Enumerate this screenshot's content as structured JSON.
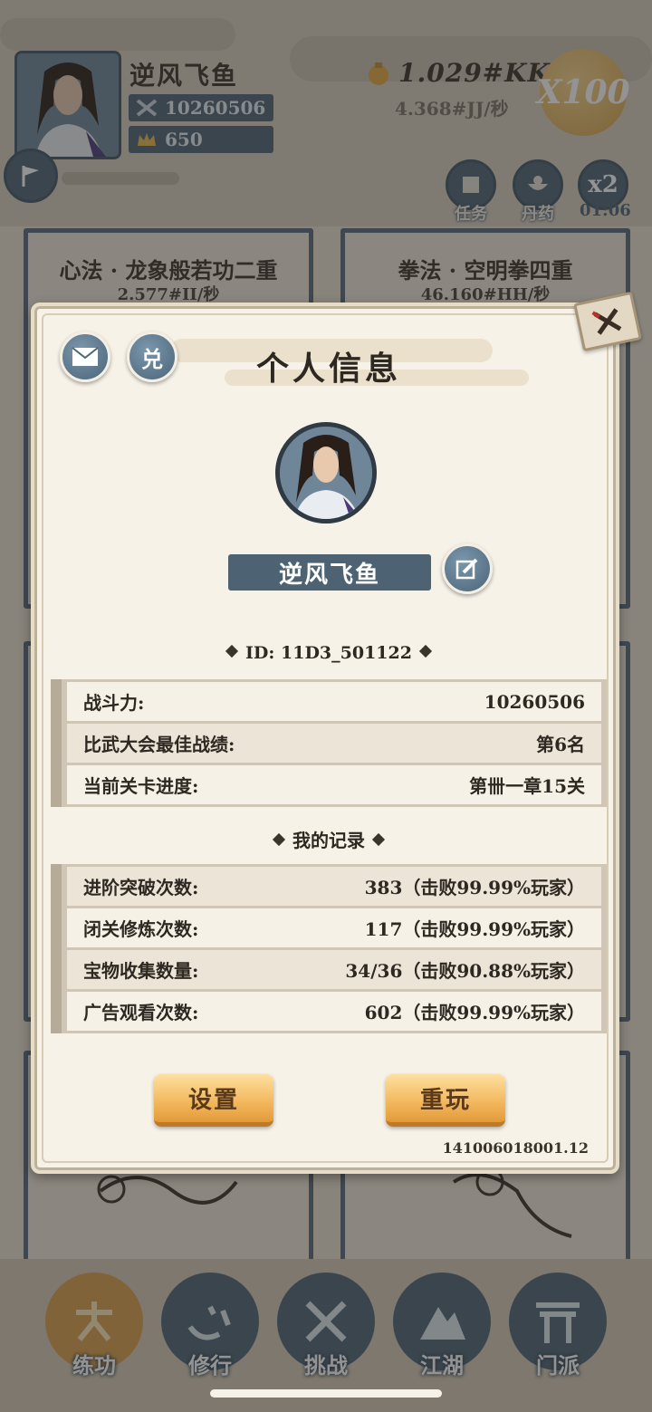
{
  "player": {
    "name": "逆风飞鱼",
    "power": "10260506",
    "crown": "650"
  },
  "currency": {
    "gold": "1.029#KK",
    "rate": "4.368#JJ/秒",
    "multiplier": "X100"
  },
  "top_buttons": {
    "task": "任务",
    "pill": "丹药",
    "x2": "x2",
    "x2_timer": "01:06"
  },
  "skills": [
    {
      "title": "心法 · 龙象般若功二重",
      "rate": "2.577#II/秒"
    },
    {
      "title": "拳法 · 空明拳四重",
      "rate": "46.160#HH/秒"
    }
  ],
  "nav": {
    "items": [
      {
        "label": "练功",
        "icon": "practice-icon",
        "active": true
      },
      {
        "label": "修行",
        "icon": "heart-icon",
        "active": false
      },
      {
        "label": "挑战",
        "icon": "crossed-swords-icon",
        "active": false
      },
      {
        "label": "江湖",
        "icon": "mountain-icon",
        "active": false
      },
      {
        "label": "门派",
        "icon": "gate-icon",
        "active": false
      }
    ]
  },
  "dialog": {
    "title": "个人信息",
    "redeem_label": "兑",
    "name": "逆风飞鱼",
    "id_text": "ID: 11D3_501122",
    "info_rows": [
      {
        "label": "战斗力:",
        "value": "10260506"
      },
      {
        "label": "比武大会最佳战绩:",
        "value": "第6名"
      },
      {
        "label": "当前关卡进度:",
        "value": "第卌一章15关"
      }
    ],
    "records_title": "我的记录",
    "record_rows": [
      {
        "label": "进阶突破次数:",
        "value": "383（击败99.99%玩家）"
      },
      {
        "label": "闭关修炼次数:",
        "value": "117（击败99.99%玩家）"
      },
      {
        "label": "宝物收集数量:",
        "value": "34/36（击败90.88%玩家）"
      },
      {
        "label": "广告观看次数:",
        "value": "602（击败99.99%玩家）"
      }
    ],
    "settings_label": "设置",
    "replay_label": "重玩",
    "version": "141006018001.12"
  },
  "colors": {
    "accent_slate": "#4d6272",
    "gold_button": "#f2b75c",
    "paper": "#f7f2e8"
  }
}
